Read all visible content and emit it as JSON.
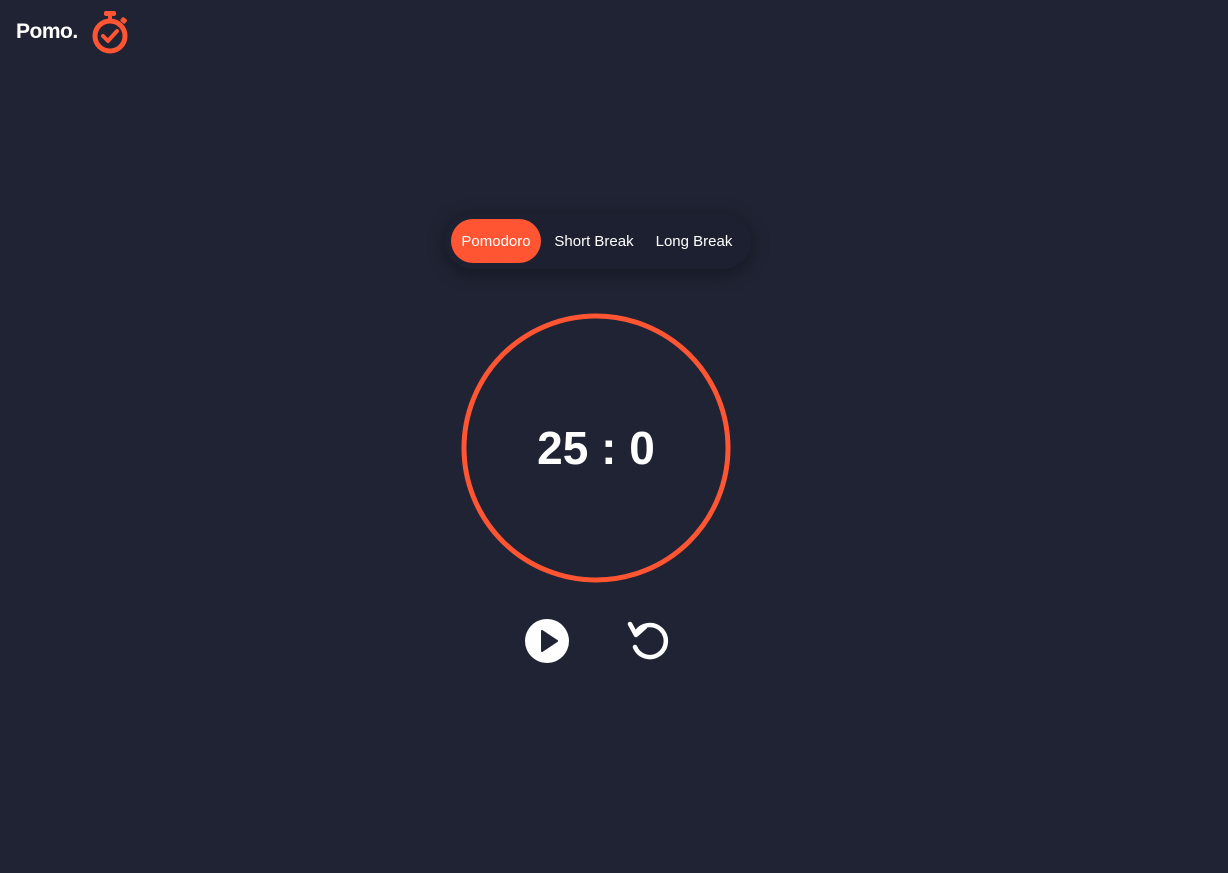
{
  "app": {
    "logo_text": "Pomo.",
    "logo_icon": "stopwatch-check-icon",
    "accent_color": "#ff5533",
    "background_color": "#1f2333"
  },
  "modes": {
    "items": [
      {
        "label": "Pomodoro",
        "active": true
      },
      {
        "label": "Short Break",
        "active": false
      },
      {
        "label": "Long Break",
        "active": false
      }
    ]
  },
  "timer": {
    "display": "25 : 0",
    "progress": 1.0
  },
  "controls": {
    "play_icon": "play-icon",
    "reset_icon": "reset-icon"
  }
}
